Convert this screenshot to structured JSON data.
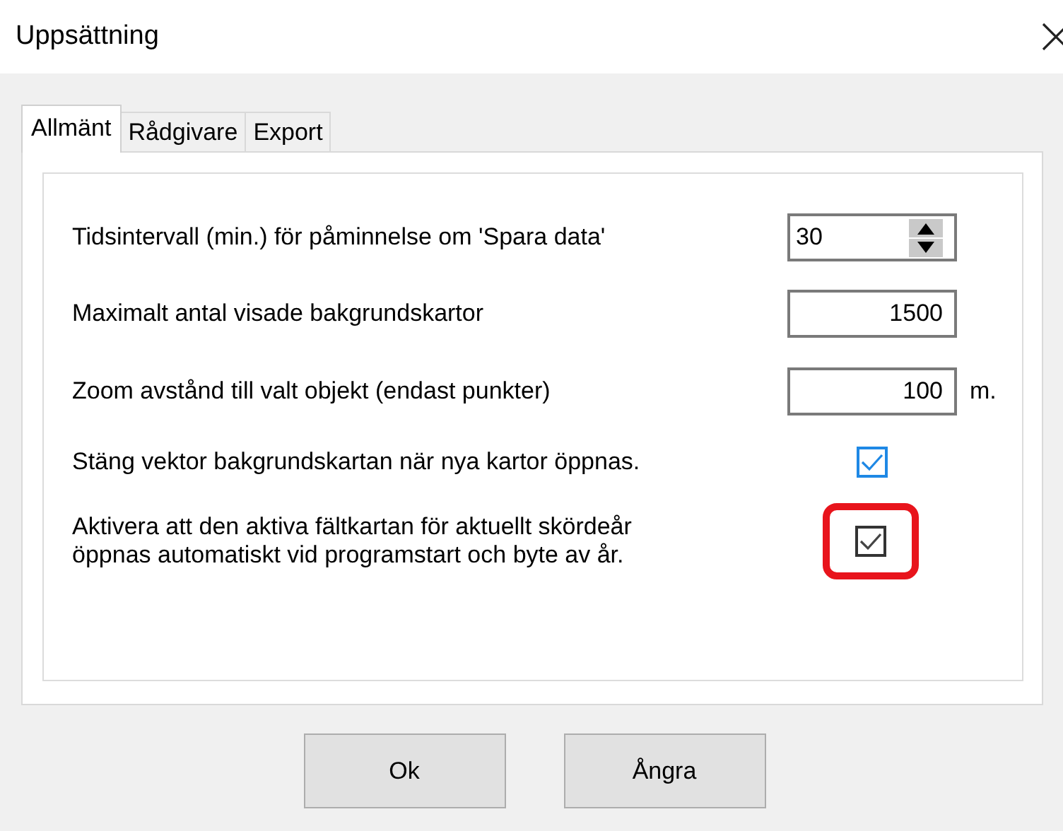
{
  "window": {
    "title": "Uppsättning"
  },
  "tabs": [
    {
      "label": "Allmänt",
      "selected": true
    },
    {
      "label": "Rådgivare",
      "selected": false
    },
    {
      "label": "Export",
      "selected": false
    }
  ],
  "settings": [
    {
      "kind": "spinner",
      "label": "Tidsintervall (min.) för påminnelse om 'Spara data'",
      "value": "30"
    },
    {
      "kind": "number",
      "label": "Maximalt antal visade bakgrundskartor",
      "value": "1500"
    },
    {
      "kind": "number",
      "label": "Zoom avstånd till valt objekt (endast punkter)",
      "value": "100",
      "unit": "m."
    },
    {
      "kind": "checkbox",
      "label": "Stäng vektor bakgrundskartan när nya kartor öppnas.",
      "checked": true,
      "focused": true,
      "highlighted": false
    },
    {
      "kind": "checkbox",
      "label": "Aktivera att den aktiva fältkartan för aktuellt skördeår\nöppnas automatiskt vid programstart och byte av år.",
      "checked": true,
      "focused": false,
      "highlighted": true
    }
  ],
  "buttons": [
    "Ok",
    "Ångra"
  ]
}
